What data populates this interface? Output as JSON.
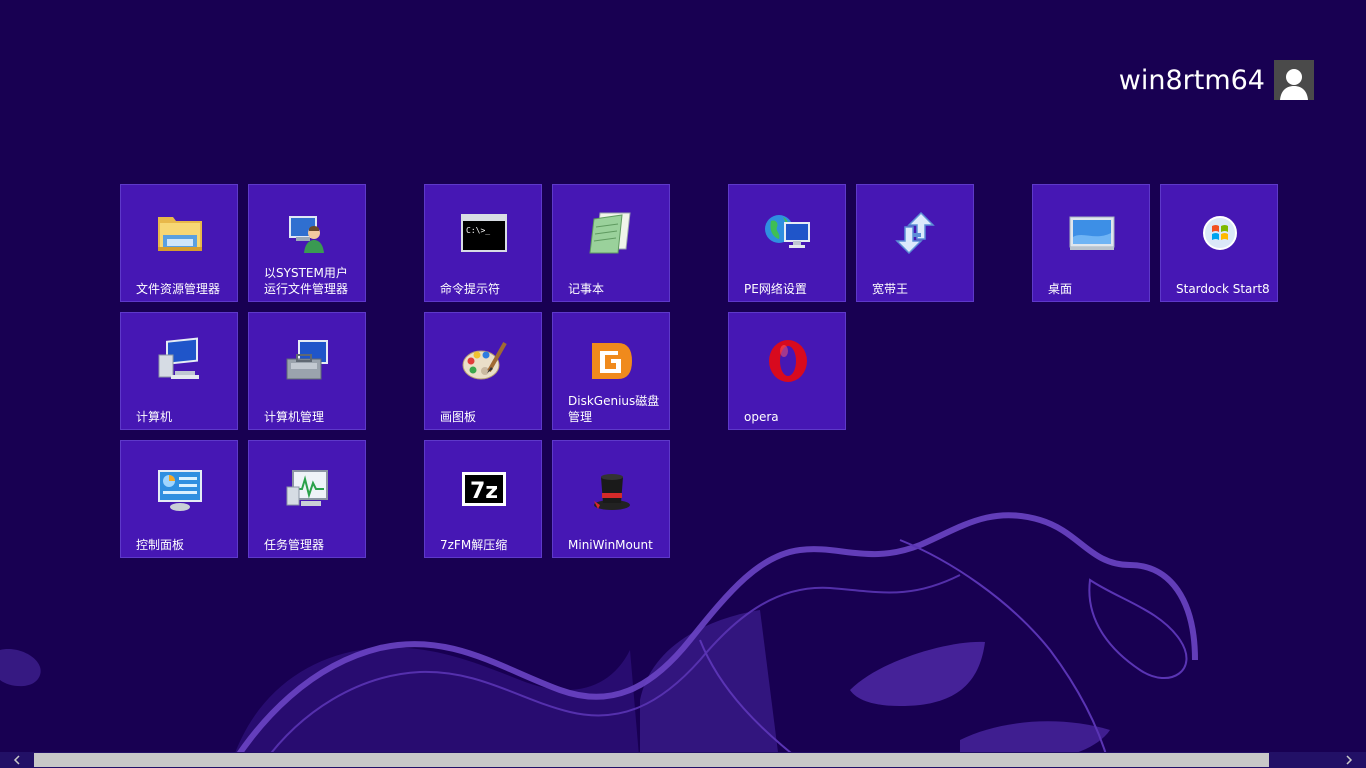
{
  "user": {
    "name": "win8rtm64"
  },
  "tiles": [
    {
      "label": "文件资源管理器",
      "icon": "file-explorer-icon"
    },
    {
      "label": "以SYSTEM用户\n运行文件管理器",
      "icon": "system-user-icon"
    },
    {
      "label": "命令提示符",
      "icon": "command-prompt-icon"
    },
    {
      "label": "记事本",
      "icon": "notepad-icon"
    },
    {
      "label": "PE网络设置",
      "icon": "network-settings-icon"
    },
    {
      "label": "宽带王",
      "icon": "broadband-icon"
    },
    {
      "label": "桌面",
      "icon": "desktop-icon"
    },
    {
      "label": "Stardock Start8",
      "icon": "start8-icon"
    },
    {
      "label": "计算机",
      "icon": "computer-icon"
    },
    {
      "label": "计算机管理",
      "icon": "computer-management-icon"
    },
    {
      "label": "画图板",
      "icon": "paint-icon"
    },
    {
      "label": "DiskGenius磁盘\n管理",
      "icon": "diskgenius-icon"
    },
    {
      "label": "opera",
      "icon": "opera-icon"
    },
    {
      "label": "控制面板",
      "icon": "control-panel-icon"
    },
    {
      "label": "任务管理器",
      "icon": "task-manager-icon"
    },
    {
      "label": "7zFM解压缩",
      "icon": "7zip-icon"
    },
    {
      "label": "MiniWinMount",
      "icon": "miniwinmount-icon"
    }
  ],
  "icon_text": {
    "cmd": "C:\\>_",
    "sevenzip": "7z"
  },
  "colors": {
    "background": "#180052",
    "tile": "#4617b4",
    "tile_border": "#5e39c9",
    "scrollbar_thumb": "#c8c8c8"
  }
}
